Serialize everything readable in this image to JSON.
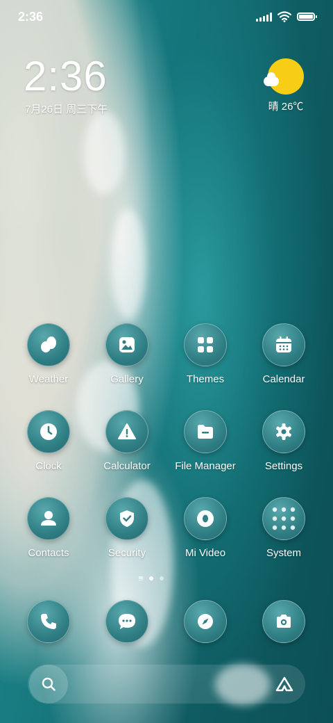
{
  "status_bar": {
    "time": "2:36",
    "icons": [
      "signal-icon",
      "wifi-icon",
      "battery-icon"
    ]
  },
  "clock_widget": {
    "time": "2:36",
    "date": "7月26日 周三下午"
  },
  "weather_widget": {
    "icon": "sunny-cloud-icon",
    "text": "晴 26℃",
    "sun_color": "#f7cd16"
  },
  "apps": [
    {
      "label": "Weather",
      "icon": "weather-icon"
    },
    {
      "label": "Gallery",
      "icon": "gallery-icon"
    },
    {
      "label": "Themes",
      "icon": "themes-icon"
    },
    {
      "label": "Calendar",
      "icon": "calendar-icon"
    },
    {
      "label": "Clock",
      "icon": "clock-icon"
    },
    {
      "label": "Calculator",
      "icon": "calculator-icon"
    },
    {
      "label": "File Manager",
      "icon": "file-manager-icon"
    },
    {
      "label": "Settings",
      "icon": "settings-icon"
    },
    {
      "label": "Contacts",
      "icon": "contacts-icon"
    },
    {
      "label": "Security",
      "icon": "security-icon"
    },
    {
      "label": "Mi Video",
      "icon": "mi-video-icon"
    },
    {
      "label": "System",
      "icon": "folder-icon"
    }
  ],
  "dock": [
    {
      "icon": "phone-icon"
    },
    {
      "icon": "messages-icon"
    },
    {
      "icon": "browser-icon"
    },
    {
      "icon": "camera-icon"
    }
  ],
  "pager": {
    "pages": 2,
    "current": 1
  },
  "bottom_bar": {
    "search_icon": "search-icon",
    "assistant_icon": "assistant-icon"
  },
  "colors": {
    "icon_bg": "#2f7f85",
    "accent_sun": "#f7cd16"
  }
}
